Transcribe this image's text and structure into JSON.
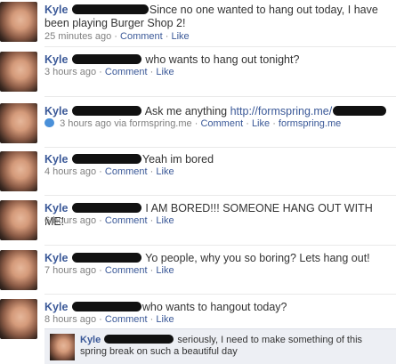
{
  "posts": [
    {
      "name": "Kyle",
      "text": "Since no one wanted to hang out today, I have been playing Burger Shop 2!",
      "time": "25 minutes ago",
      "actions": [
        "Comment",
        "Like"
      ]
    },
    {
      "name": "Kyle",
      "text": "who wants to hang out tonight?",
      "time": "3 hours ago",
      "actions": [
        "Comment",
        "Like"
      ]
    },
    {
      "name": "Kyle",
      "text": "Ask me anything",
      "url": "http://formspring.me/",
      "time": "3 hours ago",
      "via": "via formspring.me",
      "actions": [
        "Comment",
        "Like",
        "formspring.me"
      ]
    },
    {
      "name": "Kyle",
      "text": "Yeah im bored",
      "time": "4 hours ago",
      "actions": [
        "Comment",
        "Like"
      ]
    },
    {
      "name": "Kyle",
      "text": "I AM BORED!!! SOMEONE HANG OUT WITH ME!",
      "time": "6 hours ago",
      "actions": [
        "Comment",
        "Like"
      ]
    },
    {
      "name": "Kyle",
      "text": "Yo people, why you so boring? Lets hang out!",
      "time": "7 hours ago",
      "actions": [
        "Comment",
        "Like"
      ]
    },
    {
      "name": "Kyle",
      "text": "who wants to hangout today?",
      "time": "8 hours ago",
      "actions": [
        "Comment",
        "Like"
      ]
    }
  ],
  "comment": {
    "name": "Kyle",
    "text": "seriously, I need to make something of this spring break on such a beautiful day"
  },
  "separator": "·"
}
